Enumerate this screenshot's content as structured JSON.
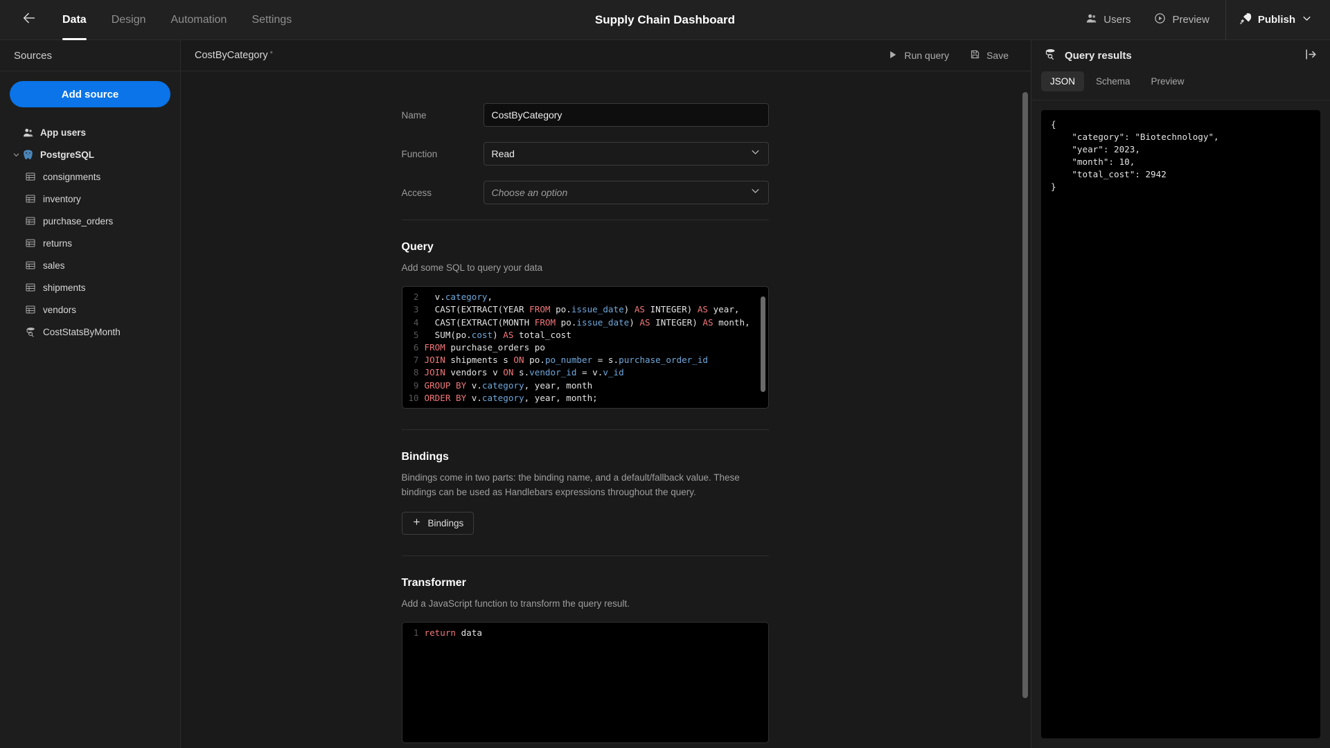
{
  "topbar": {
    "back_icon": "arrow-left-icon",
    "tabs": [
      {
        "label": "Data",
        "active": true
      },
      {
        "label": "Design",
        "active": false
      },
      {
        "label": "Automation",
        "active": false
      },
      {
        "label": "Settings",
        "active": false
      }
    ],
    "app_title": "Supply Chain Dashboard",
    "users_label": "Users",
    "users_icon": "user-icon",
    "preview_label": "Preview",
    "preview_icon": "play-circle-icon",
    "publish_label": "Publish",
    "publish_icon": "rocket-icon",
    "publish_chevron": "chevron-down-icon"
  },
  "sidebar": {
    "header": "Sources",
    "add_source_label": "Add source",
    "items": [
      {
        "label": "App users",
        "icon": "users-icon",
        "level": 0,
        "expandable": false
      },
      {
        "label": "PostgreSQL",
        "icon": "postgresql-icon",
        "level": 0,
        "expandable": true,
        "expanded": true
      },
      {
        "label": "consignments",
        "icon": "table-icon",
        "level": 1
      },
      {
        "label": "inventory",
        "icon": "table-icon",
        "level": 1
      },
      {
        "label": "purchase_orders",
        "icon": "table-icon",
        "level": 1
      },
      {
        "label": "returns",
        "icon": "table-icon",
        "level": 1
      },
      {
        "label": "sales",
        "icon": "table-icon",
        "level": 1
      },
      {
        "label": "shipments",
        "icon": "table-icon",
        "level": 1
      },
      {
        "label": "vendors",
        "icon": "table-icon",
        "level": 1
      },
      {
        "label": "CostStatsByMonth",
        "icon": "query-icon",
        "level": 1
      }
    ]
  },
  "main": {
    "tab_name": "CostByCategory",
    "unsaved_marker": "*",
    "run_query_label": "Run query",
    "run_query_icon": "play-icon",
    "save_label": "Save",
    "save_icon": "floppy-disk-icon",
    "fields": {
      "name_label": "Name",
      "name_value": "CostByCategory",
      "function_label": "Function",
      "function_value": "Read",
      "access_label": "Access",
      "access_placeholder": "Choose an option"
    },
    "query_section": {
      "title": "Query",
      "subtitle": "Add some SQL to query your data",
      "lines": [
        {
          "n": "2",
          "parts": [
            {
              "t": "  v.",
              "c": "plain"
            },
            {
              "t": "category",
              "c": "fld"
            },
            {
              "t": ",",
              "c": "plain"
            }
          ]
        },
        {
          "n": "3",
          "parts": [
            {
              "t": "  CAST(EXTRACT(YEAR ",
              "c": "plain"
            },
            {
              "t": "FROM",
              "c": "kw"
            },
            {
              "t": " po.",
              "c": "plain"
            },
            {
              "t": "issue_date",
              "c": "fld"
            },
            {
              "t": ") ",
              "c": "plain"
            },
            {
              "t": "AS",
              "c": "kw"
            },
            {
              "t": " INTEGER) ",
              "c": "plain"
            },
            {
              "t": "AS",
              "c": "kw"
            },
            {
              "t": " year,",
              "c": "plain"
            }
          ]
        },
        {
          "n": "4",
          "parts": [
            {
              "t": "  CAST(EXTRACT(MONTH ",
              "c": "plain"
            },
            {
              "t": "FROM",
              "c": "kw"
            },
            {
              "t": " po.",
              "c": "plain"
            },
            {
              "t": "issue_date",
              "c": "fld"
            },
            {
              "t": ") ",
              "c": "plain"
            },
            {
              "t": "AS",
              "c": "kw"
            },
            {
              "t": " INTEGER) ",
              "c": "plain"
            },
            {
              "t": "AS",
              "c": "kw"
            },
            {
              "t": " month,",
              "c": "plain"
            }
          ]
        },
        {
          "n": "5",
          "parts": [
            {
              "t": "  SUM(po.",
              "c": "plain"
            },
            {
              "t": "cost",
              "c": "fld"
            },
            {
              "t": ") ",
              "c": "plain"
            },
            {
              "t": "AS",
              "c": "kw"
            },
            {
              "t": " total_cost",
              "c": "plain"
            }
          ]
        },
        {
          "n": "6",
          "parts": [
            {
              "t": "FROM",
              "c": "kw"
            },
            {
              "t": " purchase_orders po",
              "c": "plain"
            }
          ]
        },
        {
          "n": "7",
          "parts": [
            {
              "t": "JOIN",
              "c": "kw"
            },
            {
              "t": " shipments s ",
              "c": "plain"
            },
            {
              "t": "ON",
              "c": "kw"
            },
            {
              "t": " po.",
              "c": "plain"
            },
            {
              "t": "po_number",
              "c": "fld"
            },
            {
              "t": " = s.",
              "c": "plain"
            },
            {
              "t": "purchase_order_id",
              "c": "fld"
            }
          ]
        },
        {
          "n": "8",
          "parts": [
            {
              "t": "JOIN",
              "c": "kw"
            },
            {
              "t": " vendors v ",
              "c": "plain"
            },
            {
              "t": "ON",
              "c": "kw"
            },
            {
              "t": " s.",
              "c": "plain"
            },
            {
              "t": "vendor_id",
              "c": "fld"
            },
            {
              "t": " = v.",
              "c": "plain"
            },
            {
              "t": "v_id",
              "c": "fld"
            }
          ]
        },
        {
          "n": "9",
          "parts": [
            {
              "t": "GROUP BY",
              "c": "kw"
            },
            {
              "t": " v.",
              "c": "plain"
            },
            {
              "t": "category",
              "c": "fld"
            },
            {
              "t": ", year, month",
              "c": "plain"
            }
          ]
        },
        {
          "n": "10",
          "parts": [
            {
              "t": "ORDER BY",
              "c": "kw"
            },
            {
              "t": " v.",
              "c": "plain"
            },
            {
              "t": "category",
              "c": "fld"
            },
            {
              "t": ", year, month;",
              "c": "plain"
            }
          ]
        }
      ]
    },
    "bindings_section": {
      "title": "Bindings",
      "subtitle": "Bindings come in two parts: the binding name, and a default/fallback value. These bindings can be used as Handlebars expressions throughout the query.",
      "add_label": "Bindings",
      "add_icon": "plus-icon"
    },
    "transformer_section": {
      "title": "Transformer",
      "subtitle": "Add a JavaScript function to transform the query result.",
      "lines": [
        {
          "n": "1",
          "parts": [
            {
              "t": "return",
              "c": "kw"
            },
            {
              "t": " data",
              "c": "plain"
            }
          ]
        }
      ]
    }
  },
  "results": {
    "title": "Query results",
    "title_icon": "database-search-icon",
    "collapse_icon": "panel-collapse-right-icon",
    "tabs": [
      {
        "label": "JSON",
        "active": true
      },
      {
        "label": "Schema",
        "active": false
      },
      {
        "label": "Preview",
        "active": false
      }
    ],
    "json_text": "{\n    \"category\": \"Biotechnology\",\n    \"year\": 2023,\n    \"month\": 10,\n    \"total_cost\": 2942\n}"
  },
  "colors": {
    "accent": "#0a74e8",
    "bg": "#1a1a1a",
    "panel": "#1d1d1d",
    "topbar": "#212121",
    "code_bg": "#000000",
    "keyword": "#f2777a",
    "field": "#6fa8dc"
  }
}
